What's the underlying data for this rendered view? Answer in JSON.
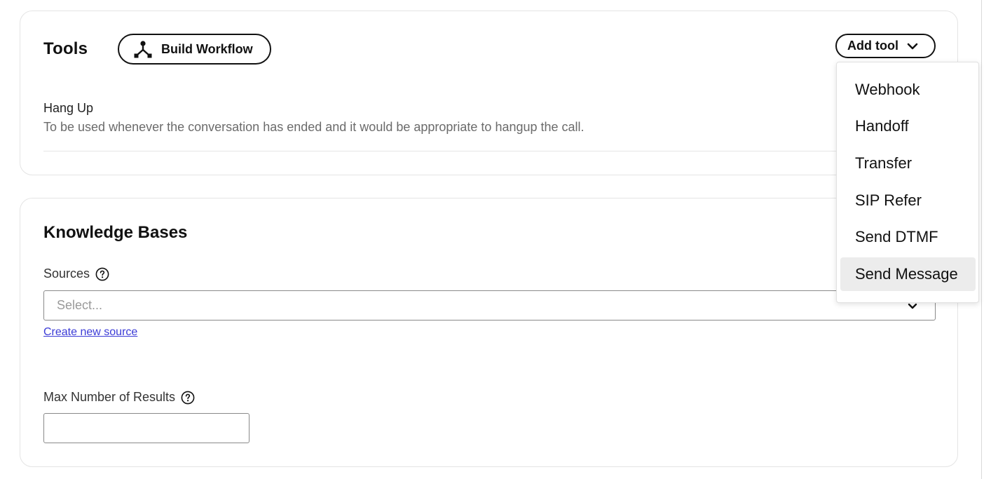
{
  "tools": {
    "title": "Tools",
    "build_workflow_label": "Build Workflow",
    "add_tool_label": "Add tool",
    "items": [
      {
        "name": "Hang Up",
        "description": "To be used whenever the conversation has ended and it would be appropriate to hangup the call."
      }
    ]
  },
  "add_tool_menu": {
    "items": [
      "Webhook",
      "Handoff",
      "Transfer",
      "SIP Refer",
      "Send DTMF",
      "Send Message"
    ],
    "highlighted": "Send Message"
  },
  "knowledge_bases": {
    "title": "Knowledge Bases",
    "sources_label": "Sources",
    "sources_placeholder": "Select...",
    "create_source_link": "Create new source",
    "max_results_label": "Max Number of Results",
    "max_results_value": ""
  },
  "icons": {
    "workflow": "workflow-icon",
    "chevron": "chevron-down-icon",
    "help": "help-circle-icon"
  },
  "colors": {
    "link": "#3b3bd6",
    "border": "#e4e4e4",
    "menu_highlight": "#ececec"
  }
}
